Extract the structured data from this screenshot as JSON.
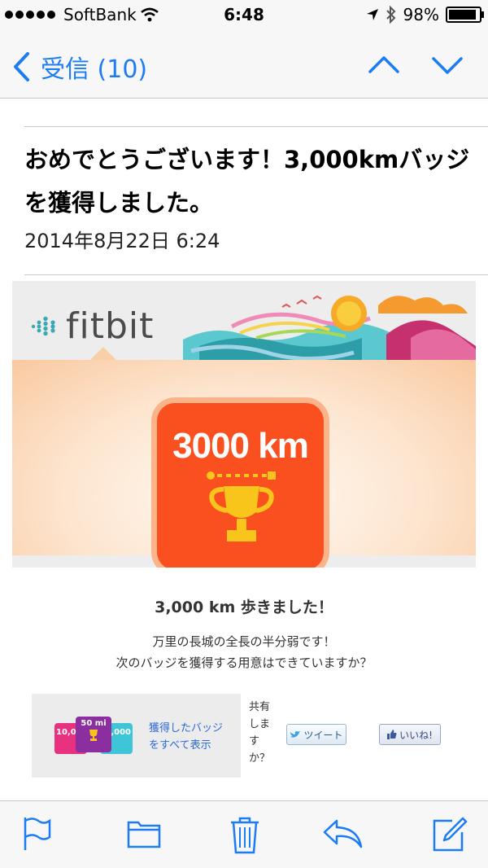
{
  "status_bar": {
    "carrier": "SoftBank",
    "time": "6:48",
    "battery": "98%"
  },
  "nav": {
    "back_label": "受信 (10)"
  },
  "email": {
    "subject": "おめでとうございます！3,000kmバッジを獲得しました。",
    "date": "2014年8月22日 6:24",
    "brand": "fitbit",
    "badge_text": "3000 km",
    "headline": "3,000 km 歩きました！",
    "desc_line1": "万里の長城の全長の半分弱です！",
    "desc_line2": "次のバッジを獲得する用意はできていますか？",
    "tile_left": "10,00",
    "tile_center": "50 mi",
    "tile_right": ",000",
    "all_badges_line1": "獲得したバッジ",
    "all_badges_line2": "をすべて表示",
    "share_q": "共有しますか？",
    "tweet_label": "ツイート",
    "like_label": "いいね!"
  },
  "toolbar": {
    "icons": [
      "flag-icon",
      "folder-icon",
      "trash-icon",
      "reply-icon",
      "compose-icon"
    ]
  },
  "colors": {
    "ios_blue": "#1b7cf5",
    "badge_orange": "#fa4f1e",
    "trophy_gold": "#f7c51c"
  }
}
